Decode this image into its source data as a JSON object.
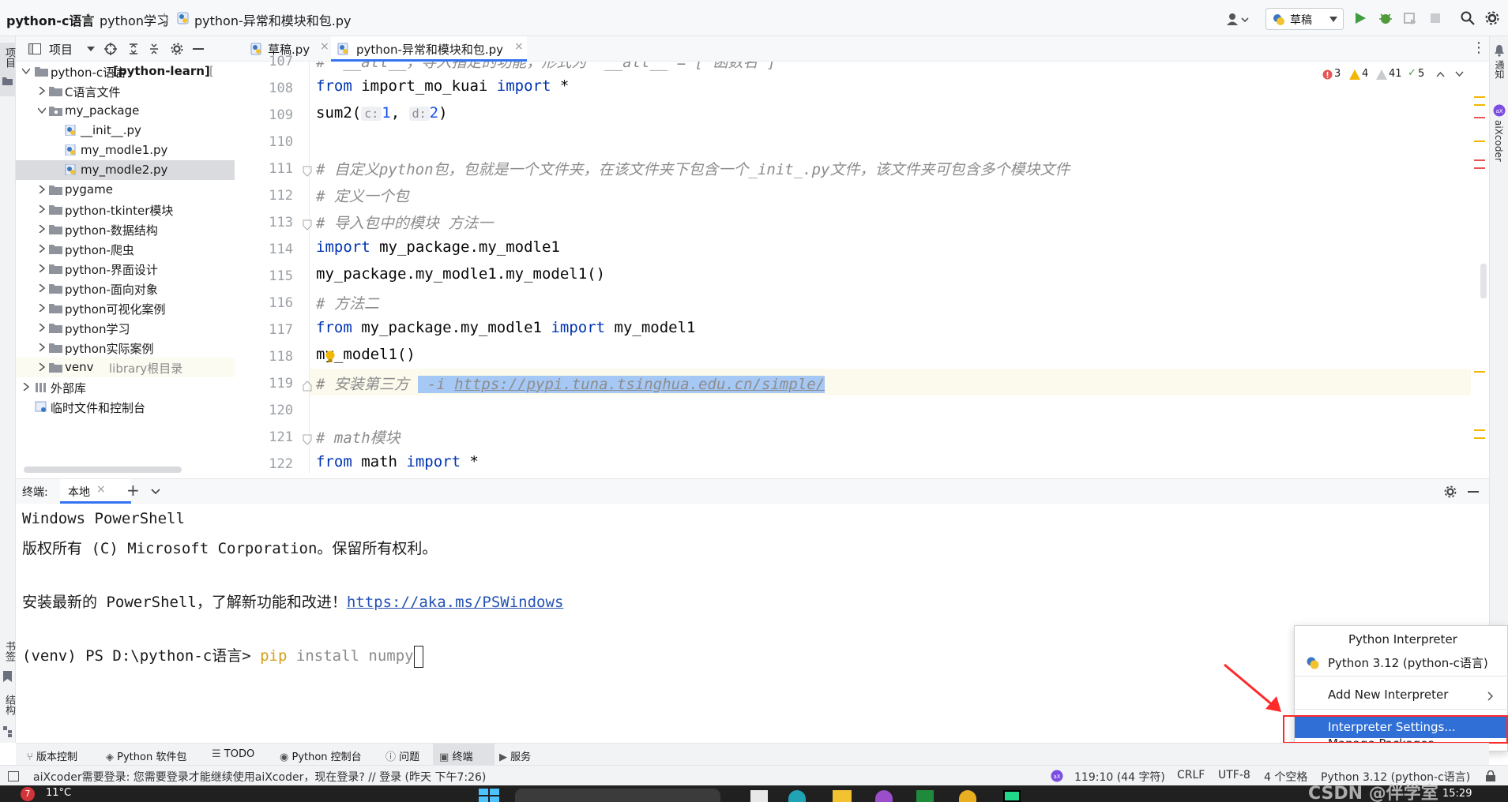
{
  "navbar": {
    "project": "python-c语言",
    "folder": "python学习",
    "file": "python-异常和模块和包.py",
    "run_config": "草稿"
  },
  "left_stripe": {
    "project_label": "项目",
    "bookmarks_label": "书签",
    "structure_label": "结构"
  },
  "right_stripe": {
    "notifications_label": "通知",
    "aixcoder_label": "aiXcoder"
  },
  "project_panel": {
    "title": "项目",
    "tree": [
      {
        "label": "python-c语言",
        "suffix": " [python-learn]",
        "extra": "[",
        "type": "root",
        "expanded": true
      },
      {
        "label": "C语言文件",
        "type": "folder",
        "expanded": false
      },
      {
        "label": "my_package",
        "type": "package",
        "expanded": true
      },
      {
        "label": "__init__.py",
        "type": "pyfile"
      },
      {
        "label": "my_modle1.py",
        "type": "pyfile"
      },
      {
        "label": "my_modle2.py",
        "type": "pyfile",
        "selected": true
      },
      {
        "label": "pygame",
        "type": "folder"
      },
      {
        "label": "python-tkinter模块",
        "type": "folder"
      },
      {
        "label": "python-数据结构",
        "type": "folder"
      },
      {
        "label": "python-爬虫",
        "type": "folder"
      },
      {
        "label": "python-界面设计",
        "type": "folder"
      },
      {
        "label": "python-面向对象",
        "type": "folder"
      },
      {
        "label": "python可视化案例",
        "type": "folder"
      },
      {
        "label": "python学习",
        "type": "folder"
      },
      {
        "label": "python实际案例",
        "type": "folder"
      },
      {
        "label": "venv",
        "suffix": "library根目录",
        "type": "folder"
      },
      {
        "label": "外部库",
        "type": "lib"
      },
      {
        "label": "临时文件和控制台",
        "type": "scratch"
      }
    ]
  },
  "editor": {
    "tabs": [
      {
        "label": "草稿.py",
        "active": false
      },
      {
        "label": "python-异常和模块和包.py",
        "active": true
      }
    ],
    "inspections": {
      "errors": "3",
      "warnings": "4",
      "weak": "41",
      "ok": "5"
    },
    "lines": [
      {
        "n": "107",
        "text": "#  __all__，导入指定的功能，形式为  __all__ = ['函数名']"
      },
      {
        "n": "108",
        "kw1": "from",
        "mid": " import_mo_kuai ",
        "kw2": "import",
        "rest": " *"
      },
      {
        "n": "109",
        "pre": "sum2(",
        "h1": "c:",
        "v1": "1",
        "sep": ", ",
        "h2": "d:",
        "v2": "2",
        "post": ")"
      },
      {
        "n": "110"
      },
      {
        "n": "111",
        "text": "# 自定义python包，包就是一个文件夹，在该文件夹下包含一个_init_.py文件，该文件夹可包含多个模块文件"
      },
      {
        "n": "112",
        "text": "# 定义一个包"
      },
      {
        "n": "113",
        "text": "# 导入包中的模块 方法一"
      },
      {
        "n": "114",
        "kw1": "import",
        "mid": " my_package.my_modle1"
      },
      {
        "n": "115",
        "code": "my_package.my_modle1.my_model1()"
      },
      {
        "n": "116",
        "text": "# 方法二"
      },
      {
        "n": "117",
        "kw1": "from",
        "mid": " my_package.my_modle1 ",
        "kw2": "import",
        "rest": " my_model1"
      },
      {
        "n": "118",
        "code": "my_model1()"
      },
      {
        "n": "119",
        "cm": "# 安装第三方 ",
        "sel1": " -i ",
        "sel2": "https://pypi.tuna.tsinghua.edu.cn/simple/"
      },
      {
        "n": "120"
      },
      {
        "n": "121",
        "text": "# math模块"
      },
      {
        "n": "122",
        "kw1": "from",
        "mid": " math ",
        "kw2": "import",
        "rest": " *"
      }
    ]
  },
  "terminal": {
    "title": "终端:",
    "tab": "本地",
    "lines": [
      "Windows PowerShell",
      "版权所有 (C) Microsoft Corporation。保留所有权利。",
      "",
      "安装最新的 PowerShell，了解新功能和改进！"
    ],
    "link": "https://aka.ms/PSWindows",
    "prompt": "(venv) PS D:\\python-c语言> ",
    "cmd_pip": "pip",
    "cmd_rest": " install numpy"
  },
  "tool_windows": [
    "版本控制",
    "Python 软件包",
    "TODO",
    "Python 控制台",
    "问题",
    "终端",
    "服务"
  ],
  "status_bar": {
    "message": "aiXcoder需要登录: 您需要登录才能继续使用aiXcoder，现在登录? // 登录 (昨天 下午7:26)",
    "position": "119:10 (44 字符)",
    "line_sep": "CRLF",
    "encoding": "UTF-8",
    "indent": "4 个空格",
    "interpreter": "Python 3.12 (python-c语言)"
  },
  "taskbar": {
    "weather": "11°C",
    "badge": "7",
    "clock": "15:29",
    "watermark": "CSDN @伴学室"
  },
  "popup": {
    "title": "Python Interpreter",
    "current": "Python 3.12 (python-c语言)",
    "add": "Add New Interpreter",
    "settings": "Interpreter Settings...",
    "manage": "Manage Packages..."
  },
  "colors": {
    "accent": "#3574f0",
    "keyword": "#0033b3",
    "comment": "#8c8c8c",
    "annotation": "#ff2a2a"
  }
}
